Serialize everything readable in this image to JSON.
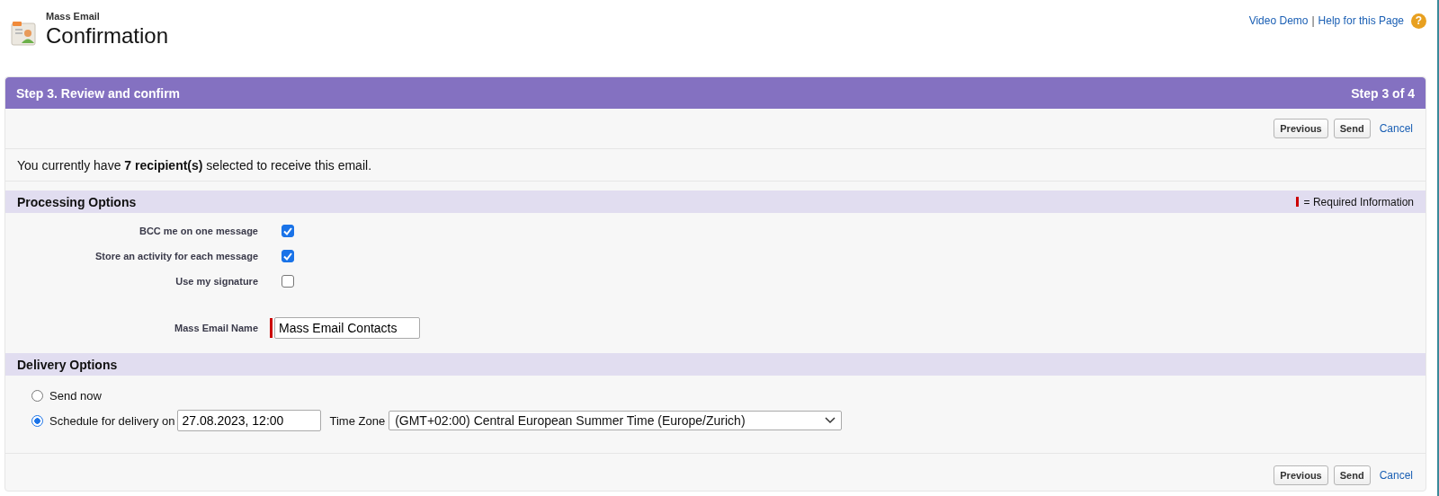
{
  "header": {
    "subtitle": "Mass Email",
    "title": "Confirmation",
    "links": [
      "Video Demo",
      "Help for this Page"
    ],
    "separator": "|",
    "help_icon": "?"
  },
  "step_bar": {
    "title": "Step 3. Review and confirm",
    "step": "Step 3 of 4"
  },
  "top_buttons": [
    {
      "label": "Previous",
      "kind": "button"
    },
    {
      "label": "Send",
      "kind": "button"
    },
    {
      "label": "Cancel",
      "kind": "link"
    }
  ],
  "recipients_text": "You currently have **7 recipient(s)** selected to receive this email.",
  "processing": {
    "title": "Processing Options",
    "required_legend": "= Required Information",
    "options": [
      {
        "label": "BCC me on one message",
        "checked": true
      },
      {
        "label": "Store an activity for each message",
        "checked": true
      },
      {
        "label": "Use my signature",
        "checked": false
      }
    ],
    "name_field": {
      "label": "Mass Email Name",
      "value": "Mass Email Contacts",
      "required": true
    }
  },
  "delivery": {
    "title": "Delivery Options",
    "options": [
      {
        "label": "Send now",
        "selected": false
      },
      {
        "label": "Schedule for delivery on",
        "selected": true,
        "date": "27.08.2023, 12:00",
        "time_zone_label": "Time Zone",
        "time_zone": "(GMT+02:00) Central European Summer Time (Europe/Zurich)"
      }
    ]
  },
  "bottom_buttons": [
    {
      "label": "Previous",
      "kind": "button"
    },
    {
      "label": "Send",
      "kind": "button"
    },
    {
      "label": "Cancel",
      "kind": "link"
    }
  ]
}
